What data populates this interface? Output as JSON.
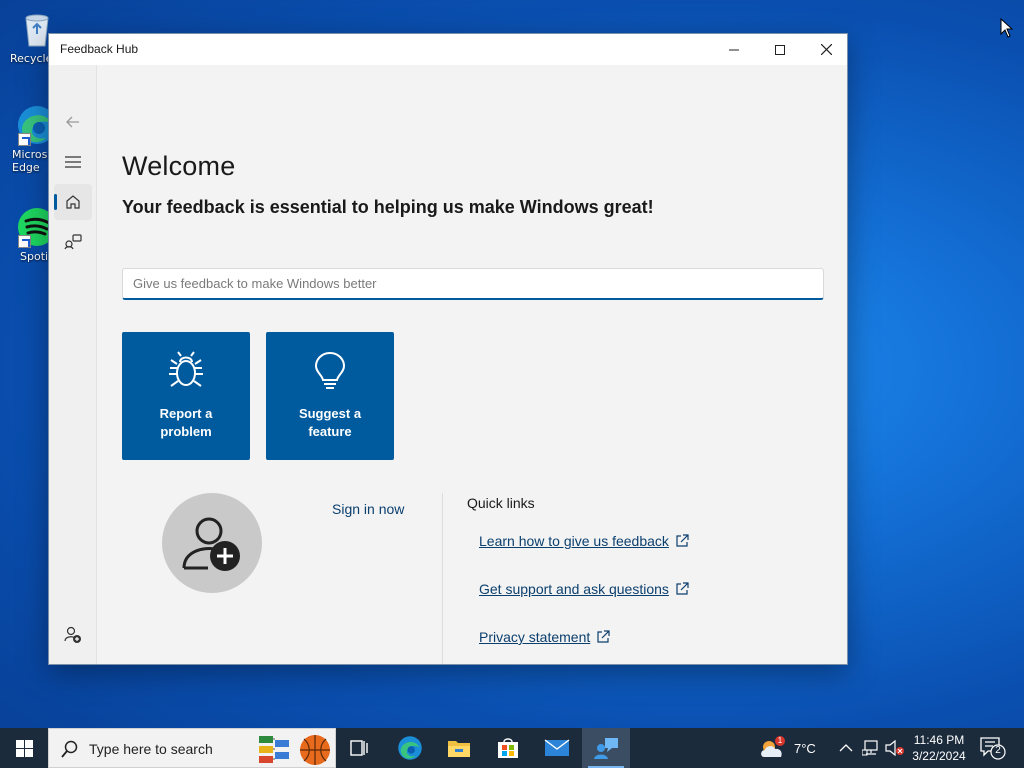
{
  "desktop": {
    "icons": [
      {
        "label": "Recycle Bin",
        "icon": "recycle-bin-icon"
      },
      {
        "label": "Microsoft Edge",
        "icon": "edge-icon"
      },
      {
        "label": "Spotify",
        "icon": "spotify-icon"
      }
    ]
  },
  "window": {
    "title": "Feedback Hub",
    "controls": {
      "minimize": "minimize-icon",
      "maximize": "maximize-icon",
      "close": "close-icon"
    }
  },
  "rail": {
    "items": [
      {
        "name": "back",
        "icon": "back-arrow-icon"
      },
      {
        "name": "menu",
        "icon": "hamburger-icon"
      },
      {
        "name": "home",
        "icon": "home-icon",
        "active": true
      },
      {
        "name": "feedback",
        "icon": "feedback-icon"
      },
      {
        "name": "add-account",
        "icon": "add-person-icon"
      },
      {
        "name": "settings",
        "icon": "gear-icon"
      }
    ]
  },
  "main": {
    "welcome": "Welcome",
    "subtitle": "Your feedback is essential to helping us make Windows great!",
    "feedback_placeholder": "Give us feedback to make Windows better",
    "tiles": {
      "report": {
        "line1": "Report a",
        "line2": "problem",
        "icon": "bug-icon"
      },
      "suggest": {
        "line1": "Suggest a",
        "line2": "feature",
        "icon": "lightbulb-icon"
      }
    },
    "sign_in": "Sign in now",
    "quick_links": {
      "title": "Quick links",
      "items": [
        "Learn how to give us feedback",
        "Get support and ask questions",
        "Privacy statement"
      ]
    }
  },
  "taskbar": {
    "search_placeholder": "Type here to search",
    "apps": [
      "task-view-icon",
      "edge-icon",
      "file-explorer-icon",
      "store-icon",
      "mail-icon",
      "feedback-hub-icon"
    ],
    "weather": {
      "temp": "7°C",
      "badge": "1"
    },
    "clock": {
      "time": "11:46 PM",
      "date": "3/22/2024"
    },
    "notifications_count": "2",
    "accent": "#005a9e"
  }
}
